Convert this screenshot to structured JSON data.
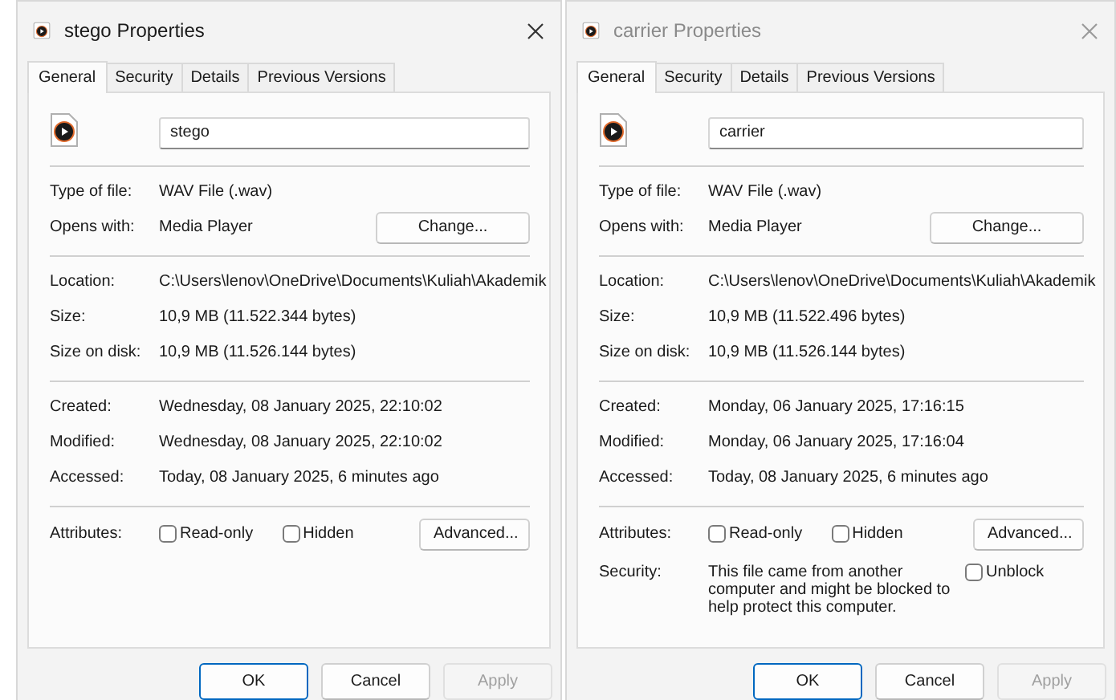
{
  "windows": [
    {
      "title": "stego Properties",
      "active": true,
      "tabs": [
        {
          "label": "General",
          "selected": true
        },
        {
          "label": "Security",
          "selected": false
        },
        {
          "label": "Details",
          "selected": false
        },
        {
          "label": "Previous Versions",
          "selected": false
        }
      ],
      "file_name": "stego",
      "sections": [
        [
          {
            "label": "Type of file:",
            "value": "WAV File (.wav)"
          },
          {
            "label": "Opens with:",
            "value": "Media Player",
            "button": "Change..."
          }
        ],
        [
          {
            "label": "Location:",
            "value": "C:\\Users\\lenov\\OneDrive\\Documents\\Kuliah\\Akademik"
          },
          {
            "label": "Size:",
            "value": "10,9 MB (11.522.344 bytes)"
          },
          {
            "label": "Size on disk:",
            "value": "10,9 MB (11.526.144 bytes)"
          }
        ],
        [
          {
            "label": "Created:",
            "value": "Wednesday, 08 January 2025, 22:10:02"
          },
          {
            "label": "Modified:",
            "value": "Wednesday, 08 January 2025, 22:10:02"
          },
          {
            "label": "Accessed:",
            "value": "Today, 08 January 2025, 6 minutes ago"
          }
        ]
      ],
      "attributes": {
        "label": "Attributes:",
        "options": [
          {
            "label": "Read-only",
            "checked": false
          },
          {
            "label": "Hidden",
            "checked": false
          }
        ],
        "button": "Advanced..."
      },
      "buttons": [
        {
          "label": "OK",
          "default": true,
          "disabled": false
        },
        {
          "label": "Cancel",
          "default": false,
          "disabled": false
        },
        {
          "label": "Apply",
          "default": false,
          "disabled": true
        }
      ]
    },
    {
      "title": "carrier Properties",
      "active": false,
      "tabs": [
        {
          "label": "General",
          "selected": true
        },
        {
          "label": "Security",
          "selected": false
        },
        {
          "label": "Details",
          "selected": false
        },
        {
          "label": "Previous Versions",
          "selected": false
        }
      ],
      "file_name": "carrier",
      "sections": [
        [
          {
            "label": "Type of file:",
            "value": "WAV File (.wav)"
          },
          {
            "label": "Opens with:",
            "value": "Media Player",
            "button": "Change..."
          }
        ],
        [
          {
            "label": "Location:",
            "value": "C:\\Users\\lenov\\OneDrive\\Documents\\Kuliah\\Akademik"
          },
          {
            "label": "Size:",
            "value": "10,9 MB (11.522.496 bytes)"
          },
          {
            "label": "Size on disk:",
            "value": "10,9 MB (11.526.144 bytes)"
          }
        ],
        [
          {
            "label": "Created:",
            "value": "Monday, 06 January 2025, 17:16:15"
          },
          {
            "label": "Modified:",
            "value": "Monday, 06 January 2025, 17:16:04"
          },
          {
            "label": "Accessed:",
            "value": "Today, 08 January 2025, 6 minutes ago"
          }
        ]
      ],
      "attributes": {
        "label": "Attributes:",
        "options": [
          {
            "label": "Read-only",
            "checked": false
          },
          {
            "label": "Hidden",
            "checked": false
          }
        ],
        "button": "Advanced..."
      },
      "security": {
        "label": "Security:",
        "text": "This file came from another computer and might be blocked to help protect this computer.",
        "option": {
          "label": "Unblock",
          "checked": false
        }
      },
      "buttons": [
        {
          "label": "OK",
          "default": true,
          "disabled": false
        },
        {
          "label": "Cancel",
          "default": false,
          "disabled": false
        },
        {
          "label": "Apply",
          "default": false,
          "disabled": true
        }
      ]
    }
  ]
}
